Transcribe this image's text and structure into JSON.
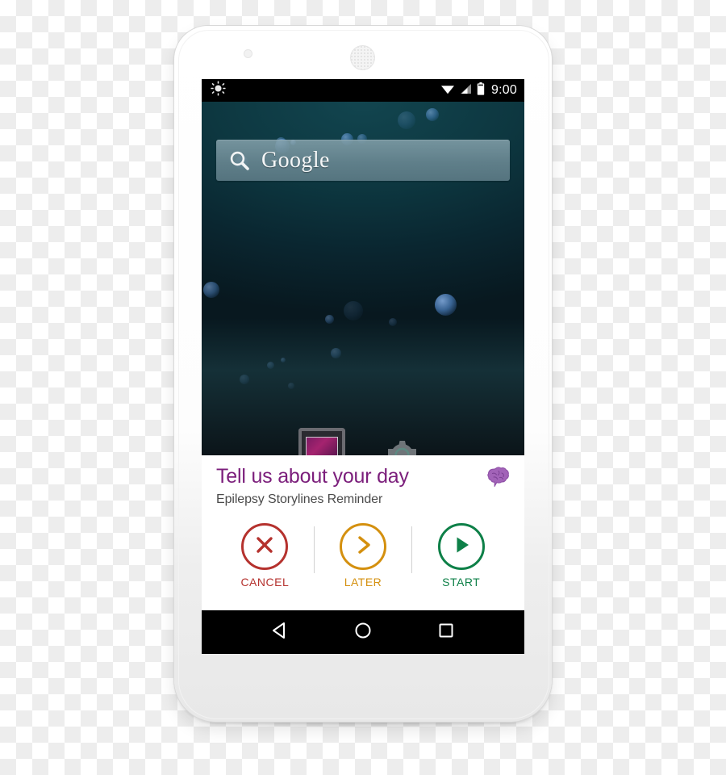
{
  "device": {
    "name": "android-phone",
    "camera_icon": "front-camera-icon",
    "speaker_icon": "earpiece-speaker-icon"
  },
  "status_bar": {
    "brightness_icon": "sun-icon",
    "wifi_icon": "wifi-icon",
    "signal_icon": "cellular-signal-icon",
    "battery_icon": "battery-icon",
    "clock": "9:00"
  },
  "home_screen": {
    "search_widget": {
      "icon": "search-icon",
      "label": "Google"
    },
    "app_icons": [
      {
        "name": "gallery-app-icon"
      },
      {
        "name": "settings-gear-app-icon"
      }
    ]
  },
  "notification_card": {
    "title": "Tell us about your day",
    "subtitle": "Epilepsy Storylines Reminder",
    "icon": "brain-icon",
    "actions": [
      {
        "label": "CANCEL",
        "icon": "close-x-icon",
        "color": "#b5322e"
      },
      {
        "label": "LATER",
        "icon": "chevron-right-icon",
        "color": "#d4900f"
      },
      {
        "label": "START",
        "icon": "play-icon",
        "color": "#0e8048"
      }
    ]
  },
  "nav_bar": {
    "back": "back-triangle-icon",
    "home": "home-circle-icon",
    "recents": "recents-square-icon"
  },
  "colors": {
    "title_purple": "#7b1e7b",
    "cancel_red": "#b5322e",
    "later_orange": "#d4900f",
    "start_green": "#0e8048"
  }
}
